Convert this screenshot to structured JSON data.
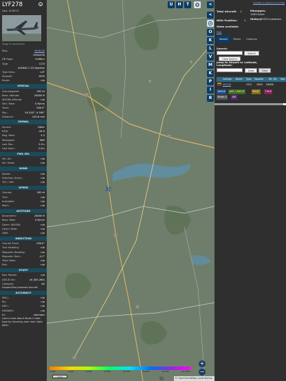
{
  "left_panel": {
    "callsign": "LYF278",
    "hex_label": "Hex:",
    "hex": "503F03",
    "close_glyph": "×",
    "photo_credit": "Image © Gerrit Griem",
    "rows_top": [
      {
        "key": "Reg.:",
        "val": "08 BLUE",
        "link": true
      },
      {
        "key": "",
        "val": "Lithuania",
        "link": false
      },
      {
        "key": "DB flags:",
        "val": "military",
        "link": false
      },
      {
        "key": "Type:",
        "val": "C27J",
        "link": false
      },
      {
        "key": "",
        "val": "ALENIA C-27J Spartan",
        "link": false
      },
      {
        "key": "Type Desc.:",
        "val": "L2T",
        "link": false
      },
      {
        "key": "Squawk:",
        "val": "1000",
        "link": false
      },
      {
        "key": "Route:",
        "val": "n/a",
        "link": false
      }
    ],
    "sec_spatial": "SPATIAL",
    "rows_spatial": [
      {
        "key": "Groundspeed:",
        "val": "302 kt"
      },
      {
        "key": "Baro. altitude:",
        "val": "24000 ft"
      },
      {
        "key": "WGS84 altitude:",
        "val": "n/a"
      },
      {
        "key": "Vert. Rate:",
        "val": "0 ft/min"
      },
      {
        "key": "Track:",
        "val": "236.0°"
      },
      {
        "key": "Pos.:",
        "val": "54.318°, 9.390°"
      },
      {
        "key": "Distance:",
        "val": "140.8 nmi"
      }
    ],
    "sec_signal": "SIGNAL",
    "rows_signal": [
      {
        "key": "Source:",
        "val": "Other"
      },
      {
        "key": "RSSI:",
        "val": "-26.9"
      },
      {
        "key": "Msg. Rate:",
        "val": "4.5"
      },
      {
        "key": "Messages:",
        "val": "669"
      },
      {
        "key": "Last Pos.:",
        "val": "2.9 s"
      },
      {
        "key": "Last Seen:",
        "val": "0.6 s"
      }
    ],
    "sec_fms": "FMS SEL",
    "rows_fms": [
      {
        "key": "Sel. Alt.:",
        "val": "n/a"
      },
      {
        "key": "Sel. Head.:",
        "val": "n/a"
      }
    ],
    "sec_wind": "WIND",
    "rows_wind": [
      {
        "key": "Speed:",
        "val": "n/a"
      },
      {
        "key": "Direction (from):",
        "val": "n/a"
      },
      {
        "key": "TAT / OAT:",
        "val": "n/a"
      }
    ],
    "sec_speed": "SPEED",
    "rows_speed": [
      {
        "key": "Ground:",
        "val": "302 kt"
      },
      {
        "key": "True:",
        "val": "n/a"
      },
      {
        "key": "Indicated:",
        "val": "n/a"
      },
      {
        "key": "Mach:",
        "val": "n/a"
      }
    ],
    "sec_altitude": "ALTITUDE",
    "rows_altitude": [
      {
        "key": "Barometric:",
        "val": "24000 ft"
      },
      {
        "key": "Baro. Rate:",
        "val": "0 ft/min"
      },
      {
        "key": "Geom. WGS84:",
        "val": "n/a"
      },
      {
        "key": "Geom. Rate:",
        "val": "n/a"
      },
      {
        "key": "QNH:",
        "val": "n/a"
      }
    ],
    "sec_direction": "DIRECTION",
    "rows_direction": [
      {
        "key": "Ground Track:",
        "val": "236.0°"
      },
      {
        "key": "True Heading:",
        "val": "n/a"
      },
      {
        "key": "Magnetic Heading:",
        "val": "n/a"
      },
      {
        "key": "Magnetic Decl.:",
        "val": "4.1°"
      },
      {
        "key": "Track Rate:",
        "val": "n/a"
      },
      {
        "key": "Roll:",
        "val": "n/a"
      }
    ],
    "sec_stuff": "STUFF",
    "rows_stuff": [
      {
        "key": "Nav. Modes:",
        "val": "n/a"
      },
      {
        "key": "ADS-B Ver.:",
        "val": "v0 (DO-260)"
      },
      {
        "key": "Category:",
        "val": "A0"
      }
    ],
    "stuff_note": "Unspecified powered aircraft",
    "sec_accuracy": "ACCURACY",
    "rows_accuracy": [
      {
        "key": "NACₚ:",
        "val": "n/a"
      },
      {
        "key": "SIL:",
        "val": "n/a"
      },
      {
        "key": "NACᵥ:",
        "val": "n/a"
      },
      {
        "key": "NICBARO:",
        "val": "n/a"
      },
      {
        "key": "Rc:",
        "val": "unknown"
      }
    ],
    "footer_note": "Learn more about Mode S data type by hovering over each data label."
  },
  "map": {
    "top_buttons": [
      "U",
      "H",
      "T"
    ],
    "legend_labels": [
      "1,000",
      "2,000",
      "4,000",
      "8,000",
      "10,000",
      "20,000",
      "30,000",
      "40,000+"
    ],
    "scale_text": "1 km",
    "attribution": "© OpenStreetMap contributors.",
    "attribution_icon": "i",
    "zoom_in": "+",
    "zoom_out": "−"
  },
  "side_strip": {
    "buttons_top": [
      "<",
      "<"
    ],
    "buttons_mid": [
      "O",
      "K",
      "L",
      "V",
      "M",
      "K",
      "P",
      "I",
      "R"
    ]
  },
  "right_panel": {
    "repo_link": "tar1090 on github (3.14.1708)",
    "total_aircraft_label": "Total Aircraft:",
    "total_aircraft": "1",
    "with_position_label": "With Position:",
    "with_position": "1",
    "stats_label": "Stats available",
    "messages_label": "Messages:",
    "messages_rate": "1263.0/sec",
    "history_label": "History:",
    "history_value": "25303 positions",
    "faq_link": "FAQ",
    "tabs": [
      "Search",
      "Filters",
      "Columns"
    ],
    "search_label": "Search:",
    "search_button": "Search",
    "clear_search_button": "Clear Search",
    "jump_label": "Jump to Airport or Latitude, Longitude:",
    "jump_button": "Jump",
    "clear_button": "Clear",
    "table_headers": [
      "Callsign",
      "Route",
      "Type",
      "Squawk",
      "Alt. (ft)",
      "Spd."
    ],
    "table_row": {
      "callsign": "LYF278",
      "route": "",
      "type": "C27J",
      "squawk": "1000",
      "alt": "24000",
      "spd": ""
    },
    "filters": [
      {
        "label": "ADS-B",
        "color": "#1c4f8f"
      },
      {
        "label": "UAT / ADS-R",
        "color": "#3d6b20"
      },
      {
        "label": "MLAT",
        "color": "#8a6c14"
      },
      {
        "label": "TIS-B",
        "color": "#8a1c5a"
      },
      {
        "label": "Mode-S",
        "color": "#555555"
      },
      {
        "label": "AIS",
        "color": "#5a2a7a"
      }
    ]
  }
}
